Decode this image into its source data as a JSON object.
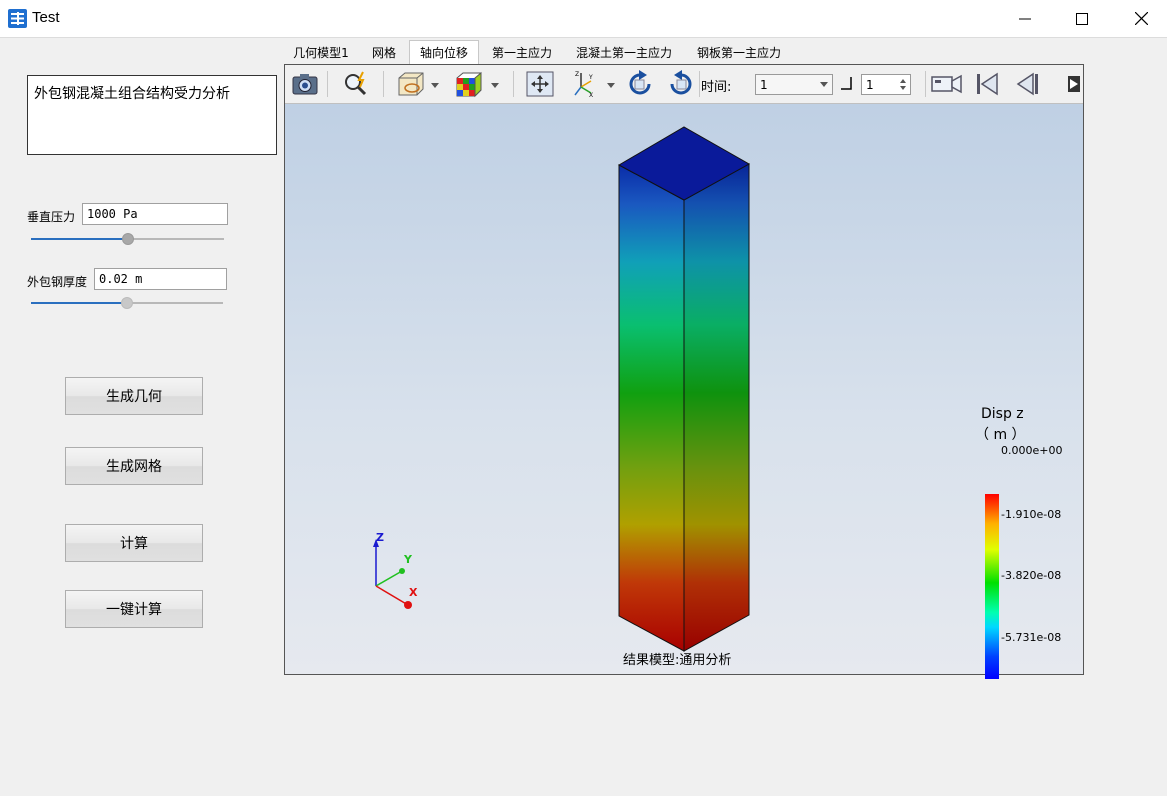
{
  "window": {
    "title": "Test",
    "controls": [
      "minimize-icon",
      "maximize-icon",
      "close-icon"
    ]
  },
  "left_panel": {
    "description": "外包钢混凝土组合结构受力分析",
    "params": [
      {
        "label": "垂直压力",
        "value": "1000 Pa",
        "slider_fraction": 0.5
      },
      {
        "label": "外包钢厚度",
        "value": "0.02 m",
        "slider_fraction": 0.5
      }
    ],
    "buttons": {
      "gen_geometry": "生成几何",
      "gen_mesh": "生成网格",
      "compute": "计算",
      "one_click": "一键计算"
    }
  },
  "tabs": [
    {
      "label": "几何模型1",
      "active": false
    },
    {
      "label": "网格",
      "active": false
    },
    {
      "label": "轴向位移",
      "active": true
    },
    {
      "label": "第一主应力",
      "active": false
    },
    {
      "label": "混凝土第一主应力",
      "active": false
    },
    {
      "label": "钢板第一主应力",
      "active": false
    }
  ],
  "toolbar": {
    "icons": [
      "camera-icon",
      "zoom-icon",
      "display-mode-icon",
      "color-cube-icon",
      "fit-view-icon",
      "axes-icon",
      "rotate-cw-icon",
      "rotate-ccw-icon",
      "record-icon",
      "first-frame-icon",
      "prev-frame-icon",
      "next-frame-icon"
    ],
    "time_label": "时间:",
    "time_value": "1",
    "step_value": "1"
  },
  "viewport": {
    "caption": "结果模型:通用分析",
    "axes": {
      "x": "X",
      "y": "Y",
      "z": "Z"
    },
    "legend": {
      "title_line1": "Disp z",
      "title_line2": "（ m ）",
      "ticks": [
        "0.000e+00",
        "-1.910e-08",
        "-3.820e-08",
        "-5.731e-08"
      ]
    }
  }
}
